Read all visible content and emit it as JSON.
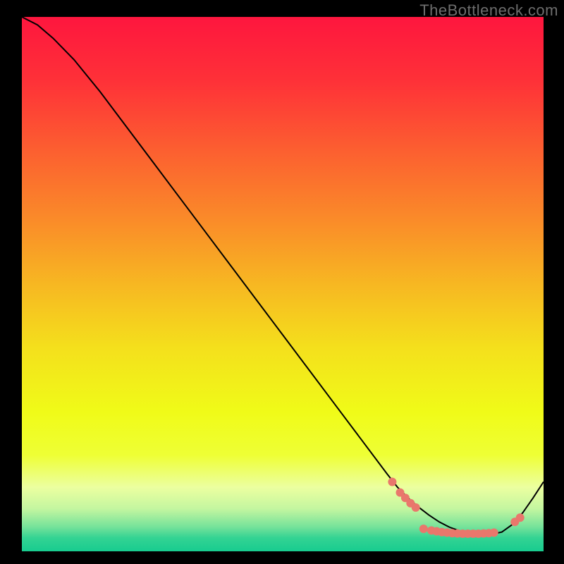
{
  "watermark": "TheBottleneck.com",
  "chart_data": {
    "type": "line",
    "title": "",
    "xlabel": "",
    "ylabel": "",
    "xlim": [
      0,
      100
    ],
    "ylim": [
      0,
      100
    ],
    "curve": {
      "x": [
        0,
        3,
        6,
        10,
        15,
        20,
        25,
        30,
        35,
        40,
        45,
        50,
        55,
        60,
        65,
        70,
        72,
        74,
        76,
        78,
        80,
        82,
        84,
        86,
        88,
        90,
        92,
        94,
        96,
        98,
        100
      ],
      "y": [
        100,
        98.5,
        96,
        92,
        86,
        79.5,
        73,
        66.5,
        60,
        53.5,
        47,
        40.5,
        34,
        27.5,
        21,
        14.5,
        12,
        10,
        8.3,
        6.8,
        5.5,
        4.5,
        3.8,
        3.4,
        3.2,
        3.2,
        3.6,
        5.0,
        7.2,
        10,
        13
      ]
    },
    "markers": [
      {
        "x": 71.0,
        "y": 13.0
      },
      {
        "x": 72.5,
        "y": 11.0
      },
      {
        "x": 73.5,
        "y": 10.0
      },
      {
        "x": 74.5,
        "y": 9.0
      },
      {
        "x": 75.5,
        "y": 8.2
      },
      {
        "x": 77.0,
        "y": 4.2
      },
      {
        "x": 78.5,
        "y": 3.9
      },
      {
        "x": 79.5,
        "y": 3.75
      },
      {
        "x": 80.5,
        "y": 3.6
      },
      {
        "x": 81.5,
        "y": 3.5
      },
      {
        "x": 82.5,
        "y": 3.4
      },
      {
        "x": 83.5,
        "y": 3.35
      },
      {
        "x": 84.5,
        "y": 3.3
      },
      {
        "x": 85.5,
        "y": 3.3
      },
      {
        "x": 86.5,
        "y": 3.3
      },
      {
        "x": 87.5,
        "y": 3.3
      },
      {
        "x": 88.5,
        "y": 3.35
      },
      {
        "x": 89.5,
        "y": 3.4
      },
      {
        "x": 90.5,
        "y": 3.5
      },
      {
        "x": 94.5,
        "y": 5.5
      },
      {
        "x": 95.5,
        "y": 6.3
      }
    ],
    "gradient_stops": [
      {
        "offset": 0.0,
        "color": "#fe163e"
      },
      {
        "offset": 0.12,
        "color": "#fe3138"
      },
      {
        "offset": 0.25,
        "color": "#fc5f30"
      },
      {
        "offset": 0.38,
        "color": "#fa8b29"
      },
      {
        "offset": 0.5,
        "color": "#f7b722"
      },
      {
        "offset": 0.62,
        "color": "#f4e01c"
      },
      {
        "offset": 0.74,
        "color": "#f0fb18"
      },
      {
        "offset": 0.82,
        "color": "#eeff35"
      },
      {
        "offset": 0.88,
        "color": "#ecffa0"
      },
      {
        "offset": 0.92,
        "color": "#c4f6a0"
      },
      {
        "offset": 0.955,
        "color": "#74e29a"
      },
      {
        "offset": 0.975,
        "color": "#33d393"
      },
      {
        "offset": 1.0,
        "color": "#18cc8f"
      }
    ],
    "marker_color": "#e9776c",
    "line_color": "#000000"
  }
}
